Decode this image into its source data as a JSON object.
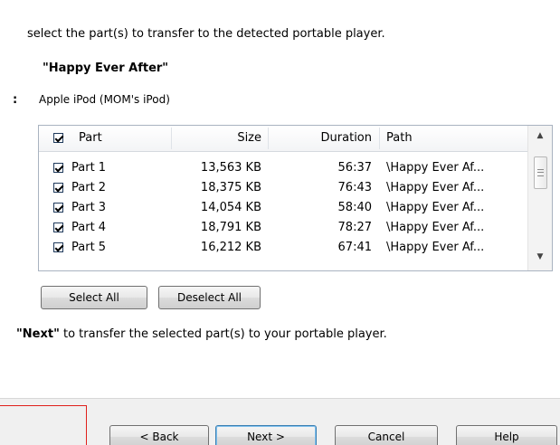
{
  "intro_text": "select the part(s) to transfer to the detected portable player.",
  "book_title": "\"Happy Ever After\"",
  "device": {
    "prefix": ":",
    "name": "Apple iPod (MOM's iPod)"
  },
  "table": {
    "header_checked": true,
    "columns": [
      "Part",
      "Size",
      "Duration",
      "Path"
    ],
    "rows": [
      {
        "checked": true,
        "part": "Part 1",
        "size": "13,563 KB",
        "duration": "56:37",
        "path": "\\Happy Ever Af..."
      },
      {
        "checked": true,
        "part": "Part 2",
        "size": "18,375 KB",
        "duration": "76:43",
        "path": "\\Happy Ever Af..."
      },
      {
        "checked": true,
        "part": "Part 3",
        "size": "14,054 KB",
        "duration": "58:40",
        "path": "\\Happy Ever Af..."
      },
      {
        "checked": true,
        "part": "Part 4",
        "size": "18,791 KB",
        "duration": "78:27",
        "path": "\\Happy Ever Af..."
      },
      {
        "checked": true,
        "part": "Part 5",
        "size": "16,212 KB",
        "duration": "67:41",
        "path": "\\Happy Ever Af..."
      }
    ]
  },
  "select_buttons": {
    "select_all": "Select All",
    "deselect_all": "Deselect All"
  },
  "next_instruction": {
    "bold": "\"Next\"",
    "rest": " to transfer the selected part(s) to your portable player."
  },
  "footer": {
    "back": "< Back",
    "next": "Next >",
    "cancel": "Cancel",
    "help": "Help"
  },
  "colors": {
    "annotation_box": "#e0201b",
    "primary_button_border": "#3c7fb1"
  }
}
